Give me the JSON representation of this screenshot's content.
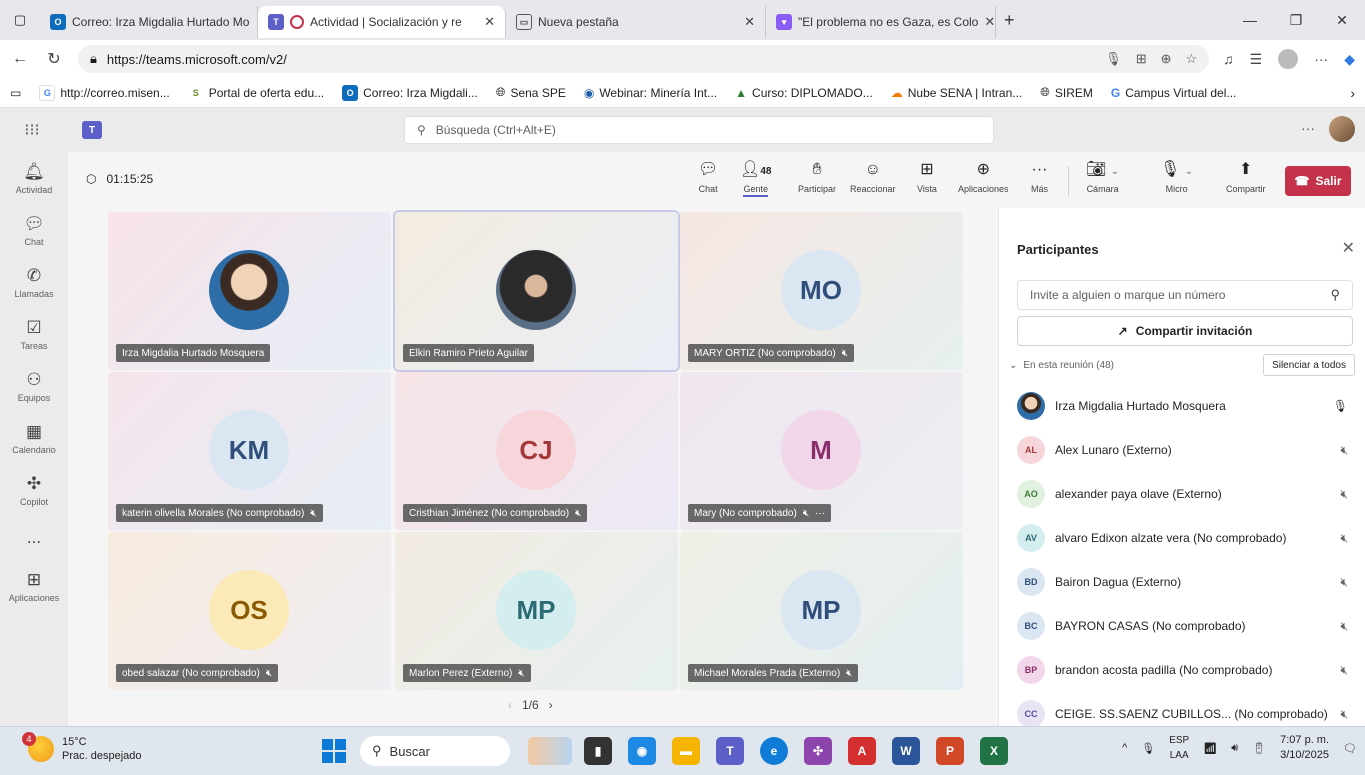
{
  "browser": {
    "tabs": [
      {
        "title": "Correo: Irza Migdalia Hurtado Mo",
        "icon": "outlook-icon",
        "color": "#0f6cbd"
      },
      {
        "title": "Actividad | Socialización y re",
        "icon": "teams-icon",
        "color": "#5b5fc7"
      },
      {
        "title": "Nueva pestaña",
        "icon": "newtab-icon",
        "color": "#555555"
      },
      {
        "title": "\"El problema no es Gaza, es Colo",
        "icon": "heart-icon",
        "color": "#8a5cf5"
      }
    ],
    "url": "https://teams.microsoft.com/v2/",
    "favorites": [
      "http://correo.misen...",
      "Portal de oferta edu...",
      "Correo: Irza Migdali...",
      "Sena SPE",
      "Webinar: Minería Int...",
      "Curso: DIPLOMADO...",
      "Nube SENA | Intran...",
      "SIREM",
      "Campus Virtual del..."
    ]
  },
  "teams": {
    "search_placeholder": "Búsqueda (Ctrl+Alt+E)",
    "rail": [
      "Actividad",
      "Chat",
      "Llamadas",
      "Tareas",
      "Equipos",
      "Calendario",
      "Copilot",
      "...",
      "Aplicaciones"
    ]
  },
  "meeting": {
    "timer": "01:15:25",
    "people_count": "48",
    "controls": [
      "Chat",
      "Gente",
      "Participar",
      "Reaccionar",
      "Vista",
      "Aplicaciones",
      "Más",
      "Cámara",
      "Micro",
      "Compartir"
    ],
    "leave_label": "Salir",
    "tiles": [
      {
        "name": "Irza Migdalia Hurtado Mosquera",
        "initials": "",
        "photo": true,
        "muted": false
      },
      {
        "name": "Elkin Ramiro Prieto Aguilar",
        "initials": "",
        "photo": true,
        "muted": false
      },
      {
        "name": "MARY ORTIZ (No comprobado)",
        "initials": "MO",
        "photo": false,
        "muted": true
      },
      {
        "name": "katerin olivella Morales (No comprobado)",
        "initials": "KM",
        "photo": false,
        "muted": true
      },
      {
        "name": "Cristhian Jiménez (No comprobado)",
        "initials": "CJ",
        "photo": false,
        "muted": true
      },
      {
        "name": "Mary (No comprobado)",
        "initials": "M",
        "photo": false,
        "muted": true
      },
      {
        "name": "obed salazar (No comprobado)",
        "initials": "OS",
        "photo": false,
        "muted": true
      },
      {
        "name": "Marlon Perez (Externo)",
        "initials": "MP",
        "photo": false,
        "muted": true
      },
      {
        "name": "Michael Morales Prada (Externo)",
        "initials": "MP",
        "photo": false,
        "muted": true
      }
    ],
    "pager": "1/6"
  },
  "participants": {
    "title": "Participantes",
    "invite_placeholder": "Invite a alguien o marque un número",
    "share_label": "Compartir invitación",
    "section_label": "En esta reunión (48)",
    "mute_all_label": "Silenciar a todos",
    "list": [
      {
        "initials": "",
        "name": "Irza Migdalia Hurtado Mosquera",
        "muted": false
      },
      {
        "initials": "AL",
        "name": "Alex Lunaro (Externo)",
        "muted": true
      },
      {
        "initials": "AO",
        "name": "alexander paya olave (Externo)",
        "muted": true
      },
      {
        "initials": "AV",
        "name": "alvaro Edixon alzate vera (No comprobado)",
        "muted": true
      },
      {
        "initials": "BD",
        "name": "Bairon Dagua (Externo)",
        "muted": true
      },
      {
        "initials": "BC",
        "name": "BAYRON CASAS (No comprobado)",
        "muted": true
      },
      {
        "initials": "BP",
        "name": "brandon acosta padilla (No comprobado)",
        "muted": true
      },
      {
        "initials": "CC",
        "name": "CEIGE. SS.SAENZ CUBILLOS... (No comprobado)",
        "muted": true
      }
    ]
  },
  "taskbar": {
    "weather_badge": "4",
    "temp": "15°C",
    "condition": "Prac. despejado",
    "search_label": "Buscar",
    "lang_1": "ESP",
    "lang_2": "LAA",
    "time": "7:07 p. m.",
    "date": "3/10/2025"
  }
}
